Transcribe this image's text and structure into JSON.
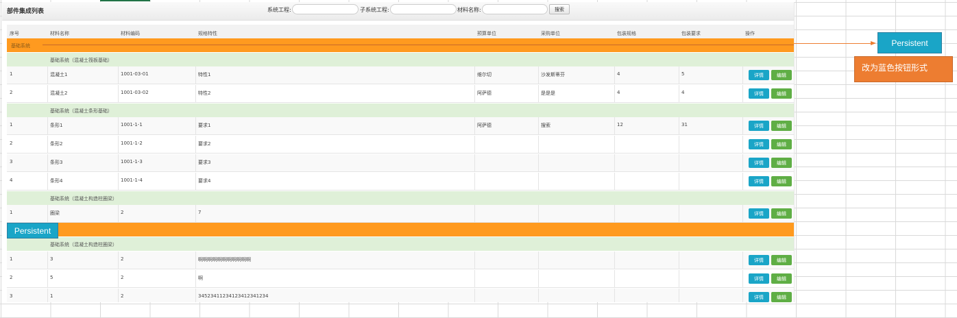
{
  "title": "部件集成列表",
  "filters": {
    "system_label": "系统工程:",
    "subsystem_label": "子系统工程:",
    "material_label": "材料名称:",
    "system_value": "",
    "subsystem_value": "",
    "material_value": "",
    "search_button": "搜索"
  },
  "columns": [
    "序号",
    "材料名称",
    "材料编码",
    "规格特性",
    "预算单位",
    "采购单位",
    "包装规格",
    "包装要求",
    "操作"
  ],
  "actions": {
    "detail": "详情",
    "edit": "编辑"
  },
  "system_row": "基础系统",
  "groups": [
    {
      "label": "基础系统（混凝土筏板基础）",
      "rows": [
        [
          "1",
          "混凝土1",
          "1001-03-01",
          "特性1",
          "维尔切",
          "沙发斯蒂芬",
          "4",
          "5"
        ],
        [
          "2",
          "混凝土2",
          "1001-03-02",
          "特性2",
          "阿萨德",
          "是是是",
          "4",
          "4"
        ]
      ]
    },
    {
      "label": "基础系统（混凝土条形基础）",
      "rows": [
        [
          "1",
          "条形1",
          "1001-1-1",
          "要求1",
          "阿萨德",
          "搜索",
          "12",
          "31"
        ],
        [
          "2",
          "条形2",
          "1001-1-2",
          "要求2",
          "",
          "",
          "",
          ""
        ],
        [
          "3",
          "条形3",
          "1001-1-3",
          "要求3",
          "",
          "",
          "",
          ""
        ],
        [
          "4",
          "条形4",
          "1001-1-4",
          "要求4",
          "",
          "",
          "",
          ""
        ]
      ]
    },
    {
      "label": "基础系统（混凝土构造柱圈梁）",
      "rows": [
        [
          "1",
          "圈梁",
          "2",
          "7",
          "",
          "",
          "",
          ""
        ]
      ]
    },
    {
      "label": "基础系统（混凝土构造柱圈梁）",
      "rows": [
        [
          "1",
          "3",
          "2",
          "啊啊啊啊啊啊啊啊啊啊啊",
          "",
          "",
          "",
          ""
        ],
        [
          "2",
          "5",
          "2",
          "啊",
          "",
          "",
          "",
          ""
        ],
        [
          "3",
          "1",
          "2",
          "34523411234123412341234",
          "",
          "",
          "",
          ""
        ]
      ]
    }
  ],
  "annotations": {
    "persistent_label": "Persistent",
    "note": "改为蓝色按钮形式",
    "arrow_color": "#ed7d31",
    "button_color": "#1aa5c7",
    "system_row_color": "#ff9a1f",
    "group_row_color": "#dff0d8"
  }
}
